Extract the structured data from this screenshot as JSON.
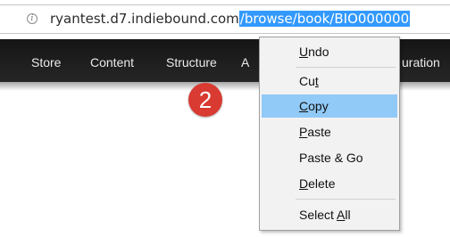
{
  "address_bar": {
    "url_host": "ryantest.d7.indiebound.com",
    "url_path_selected": "/browse/book/BIO000000",
    "info_icon": "info-icon"
  },
  "nav": {
    "items": [
      "Store",
      "Content",
      "Structure",
      "A",
      "uration"
    ]
  },
  "badge": {
    "number": "2",
    "color": "#d93a32"
  },
  "context_menu": {
    "items": [
      {
        "pre": "",
        "mn": "U",
        "post": "ndo"
      },
      {
        "pre": "Cu",
        "mn": "t",
        "post": ""
      },
      {
        "pre": "",
        "mn": "C",
        "post": "opy"
      },
      {
        "pre": "",
        "mn": "P",
        "post": "aste"
      },
      {
        "pre": "Paste & Go",
        "mn": "",
        "post": ""
      },
      {
        "pre": "",
        "mn": "D",
        "post": "elete"
      },
      {
        "pre": "Select ",
        "mn": "A",
        "post": "ll"
      }
    ],
    "highlighted_item": "Copy",
    "highlight_color": "#91c9f7"
  }
}
